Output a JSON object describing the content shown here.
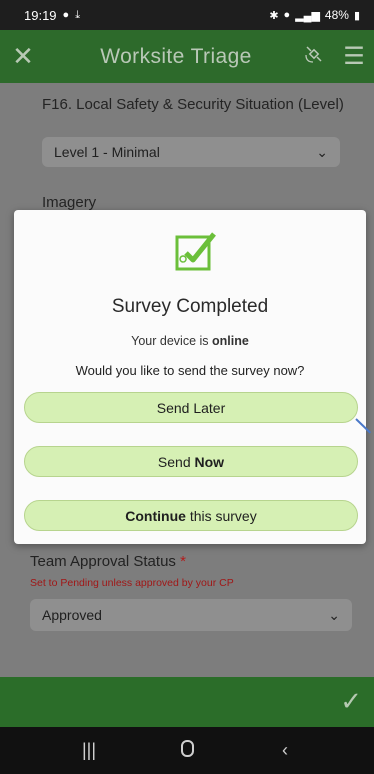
{
  "status_bar": {
    "time": "19:19",
    "battery": "48%",
    "left_icons": [
      "location-icon",
      "download-icon"
    ],
    "right_icons": [
      "bluetooth-icon",
      "location-icon",
      "signal-icon",
      "battery-icon"
    ]
  },
  "header": {
    "title": "Worksite Triage",
    "close_icon": "close-icon",
    "gps_icon": "satellite-icon",
    "menu_icon": "menu-icon"
  },
  "form": {
    "question_label": "F16. Local Safety & Security Situation (Level)",
    "question_value": "Level 1 - Minimal",
    "imagery_label": "Imagery",
    "approval_label": "Team Approval Status",
    "approval_required_mark": "*",
    "approval_hint": "Set to Pending unless approved by your CP",
    "approval_value": "Approved"
  },
  "modal": {
    "icon": "survey-check-icon",
    "title": "Survey Completed",
    "status_prefix": "Your device is",
    "status_value": "online",
    "question": "Would you like to send the survey now?",
    "send_later": "Send Later",
    "send_now_prefix": "Send",
    "send_now_bold": "Now",
    "continue_bold": "Continue",
    "continue_suffix": "this survey"
  },
  "colors": {
    "header_green": "#2d6a2b",
    "button_fill": "#d6f0b4",
    "icon_green": "#6bbf3a",
    "required_red": "#b21c1c"
  }
}
